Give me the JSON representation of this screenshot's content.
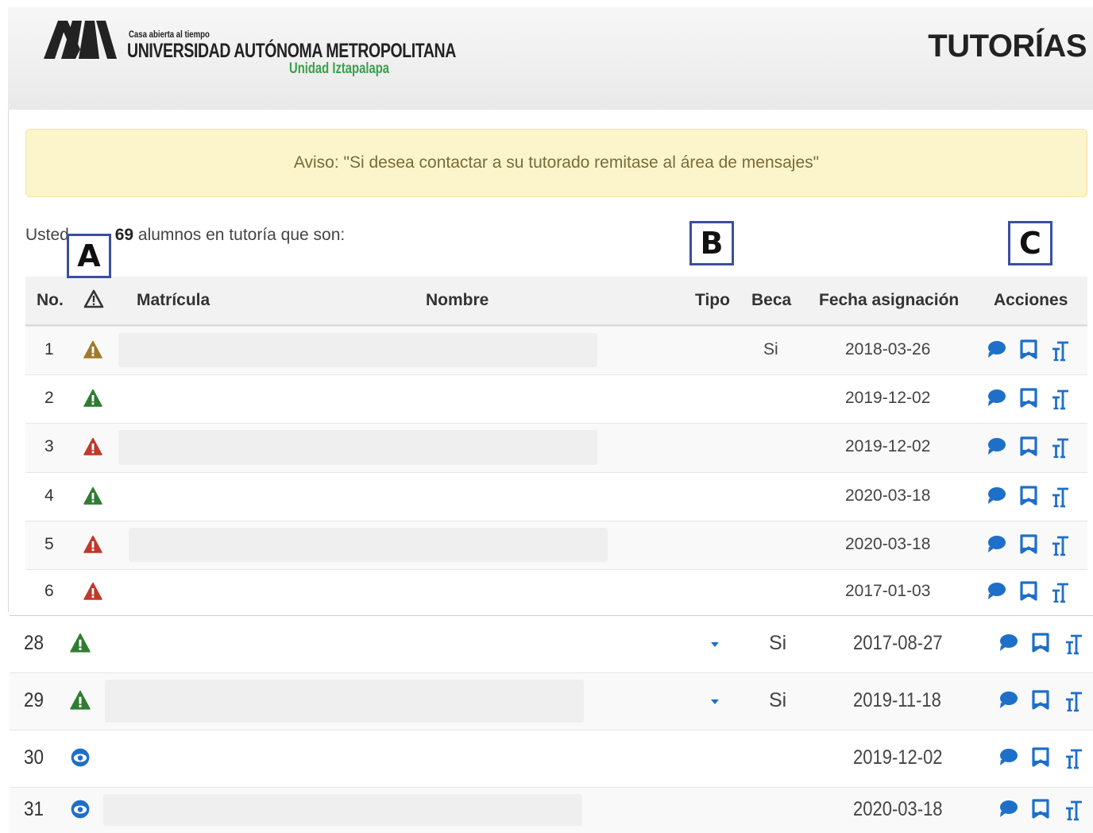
{
  "header": {
    "logo_small": "Casa abierta al tiempo",
    "logo_main": "UNIVERSIDAD AUTÓNOMA METROPOLITANA",
    "logo_sub": "Unidad Iztapalapa",
    "app_title": "TUTORÍAS"
  },
  "alert": {
    "text": "Aviso: \"Si desea contactar a su tutorado remitase al área de mensajes\""
  },
  "summary": {
    "prefix": "Usted",
    "count": "69",
    "suffix": "alumnos en tutoría que son:"
  },
  "callouts": {
    "a": "A",
    "b": "B",
    "c": "C"
  },
  "table": {
    "headers": {
      "no": "No.",
      "matricula": "Matrícula",
      "nombre": "Nombre",
      "tipo": "Tipo",
      "beca": "Beca",
      "fecha": "Fecha asignación",
      "acciones": "Acciones"
    },
    "rows": [
      {
        "no": "1",
        "status": "warning-amber",
        "beca": "Si",
        "fecha": "2018-03-26",
        "tipo_dropdown": false
      },
      {
        "no": "2",
        "status": "warning-green",
        "beca": "",
        "fecha": "2019-12-02",
        "tipo_dropdown": false
      },
      {
        "no": "3",
        "status": "warning-red",
        "beca": "",
        "fecha": "2019-12-02",
        "tipo_dropdown": false
      },
      {
        "no": "4",
        "status": "warning-green",
        "beca": "",
        "fecha": "2020-03-18",
        "tipo_dropdown": false
      },
      {
        "no": "5",
        "status": "warning-red",
        "beca": "",
        "fecha": "2020-03-18",
        "tipo_dropdown": false
      },
      {
        "no": "6",
        "status": "warning-red",
        "beca": "",
        "fecha": "2017-01-03",
        "tipo_dropdown": false
      },
      {
        "no": "28",
        "status": "warning-green",
        "beca": "Si",
        "fecha": "2017-08-27",
        "tipo_dropdown": true
      },
      {
        "no": "29",
        "status": "warning-green",
        "beca": "Si",
        "fecha": "2019-11-18",
        "tipo_dropdown": true
      },
      {
        "no": "30",
        "status": "eye-blue",
        "beca": "",
        "fecha": "2019-12-02",
        "tipo_dropdown": false
      },
      {
        "no": "31",
        "status": "eye-blue",
        "beca": "",
        "fecha": "2020-03-18",
        "tipo_dropdown": false
      }
    ],
    "actions": [
      {
        "name": "message-icon"
      },
      {
        "name": "bookmark-icon"
      },
      {
        "name": "text-size-icon"
      }
    ]
  },
  "colors": {
    "amber": "#a07a2a",
    "green": "#2e7d32",
    "red": "#c0392b",
    "blue": "#1e6fc8",
    "callout_border": "#3b4fa0",
    "alert_bg": "#fcf5cc"
  }
}
